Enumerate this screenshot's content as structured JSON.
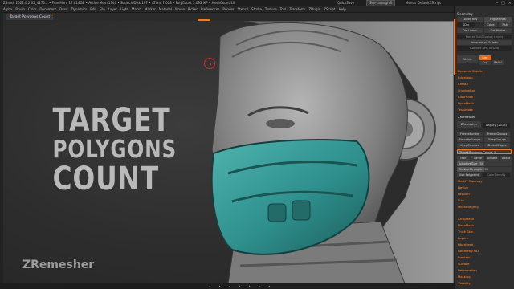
{
  "titlebar": {
    "stats": "ZBrush 2022.0.2    03_4170...  • Free Mem 17.814GB • Active Mem 1340 • Scratch Disk 107 • ATime 7.008 • PolyCount 3.093 MP • MeshCount 10",
    "quicksave": "QuickSave",
    "see_through": "See-through  0",
    "menus": "Menus",
    "default_script": "DefaultZScript"
  },
  "menubar": [
    "Alpha",
    "Brush",
    "Color",
    "Document",
    "Draw",
    "Dynamics",
    "Edit",
    "File",
    "Layer",
    "Light",
    "Macro",
    "Marker",
    "Material",
    "Movie",
    "Picker",
    "Preferences",
    "Render",
    "Stencil",
    "Stroke",
    "Texture",
    "Tool",
    "Transform",
    "ZPlugin",
    "ZScript",
    "Help"
  ],
  "document_tab": "Target Polygons Count",
  "viewport": {
    "title_line1": "TARGET",
    "title_line2": "POLYGONS",
    "title_line3": "COUNT",
    "watermark": "ZRemesher"
  },
  "bottombar": [
    "•",
    "•",
    "•",
    "•",
    "•",
    "•",
    "•"
  ],
  "palette": {
    "geometry_header": "Geometry",
    "lower_res": "Lower Res",
    "higher_res": "Higher Res",
    "sdiv": "SDiv",
    "cage": "Cage",
    "rstr": "Rstr",
    "del_lower": "Del Lower",
    "del_higher": "Del Higher",
    "freeze_subdiv": "Freeze SubDivision Levels",
    "reconstruct": "Reconstruct Subdiv",
    "convert_bpr": "Convert BPR To Geo",
    "divide": "Divide",
    "smt": "Smt",
    "suv": "Suv",
    "reuv": "ReUV",
    "dynamic_subdiv": "Dynamic Subdiv",
    "edge_loop": "EdgeLoop",
    "crease": "Crease",
    "shadowbox": "ShadowBox",
    "claypolish": "ClayPolish",
    "dynamesh": "DynaMesh",
    "tessimate": "Tessimate",
    "zremesher_header": "ZRemesher",
    "zremesher_btn": "ZRemesher",
    "legacy": "Legacy (2018)",
    "freeze_border": "FreezeBorder",
    "freeze_groups": "FreezeGroups",
    "smooth_groups": "SmoothGroups",
    "keep_groups": "KeepGroups",
    "keep_creases": "KeepCreases",
    "detect_edges": "DetectEdges",
    "target_count_label": "Target Polygons Count",
    "target_count_value": "5",
    "target_count_fraction": 0.25,
    "half": "Half",
    "same": "Same",
    "double": "Double",
    "adapt": "Adapt",
    "adaptive_size_label": "AdaptiveSize",
    "adaptive_size_value": "50",
    "adaptive_size_fraction": 0.5,
    "curves_strength_label": "Curves Strength",
    "curves_strength_value": "50",
    "curves_strength_fraction": 0.5,
    "use_polypaint": "Use Polypaint",
    "color_density": "ColorDensity",
    "modify_topology": "Modify Topology",
    "design": "Design",
    "position": "Position",
    "size": "Size",
    "mesh_integrity": "MeshIntegrity",
    "array_mesh": "ArrayMesh",
    "nano_mesh": "NanoMesh",
    "thick_skin": "Thick Skin",
    "layers": "Layers",
    "fiber_mesh": "FiberMesh",
    "geometry_hd": "Geometry HD",
    "preview": "Preview",
    "surface": "Surface",
    "deformation": "Deformation",
    "masking": "Masking",
    "visibility": "Visibility"
  },
  "colors": {
    "accent": "#ff7a1a",
    "mask_teal": "#2e8f8c",
    "helmet_gray": "#8e8e8e"
  }
}
